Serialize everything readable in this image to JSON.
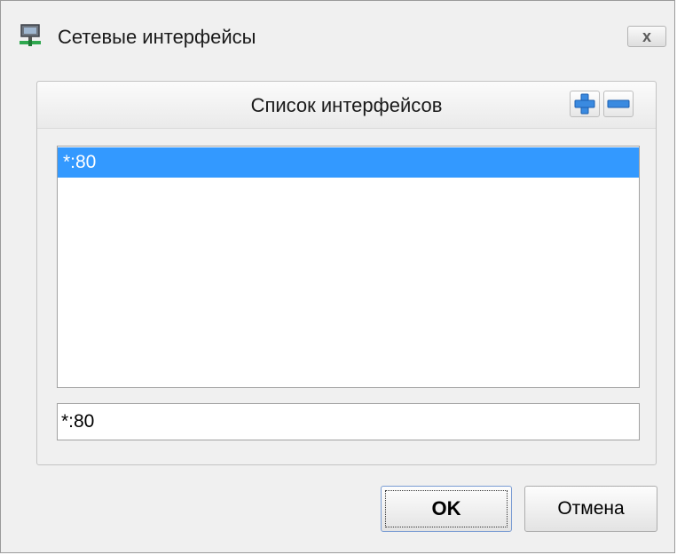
{
  "window": {
    "title": "Сетевые интерфейсы",
    "close_label": "x",
    "icon": "network-icon"
  },
  "group": {
    "title": "Список интерфейсов",
    "add_icon": "plus-icon",
    "remove_icon": "minus-icon",
    "accent_color": "#3399ff"
  },
  "list": {
    "items": [
      {
        "label": "*:80",
        "selected": true
      }
    ]
  },
  "editor": {
    "value": "*:80"
  },
  "buttons": {
    "ok_label": "OK",
    "cancel_label": "Отмена"
  }
}
